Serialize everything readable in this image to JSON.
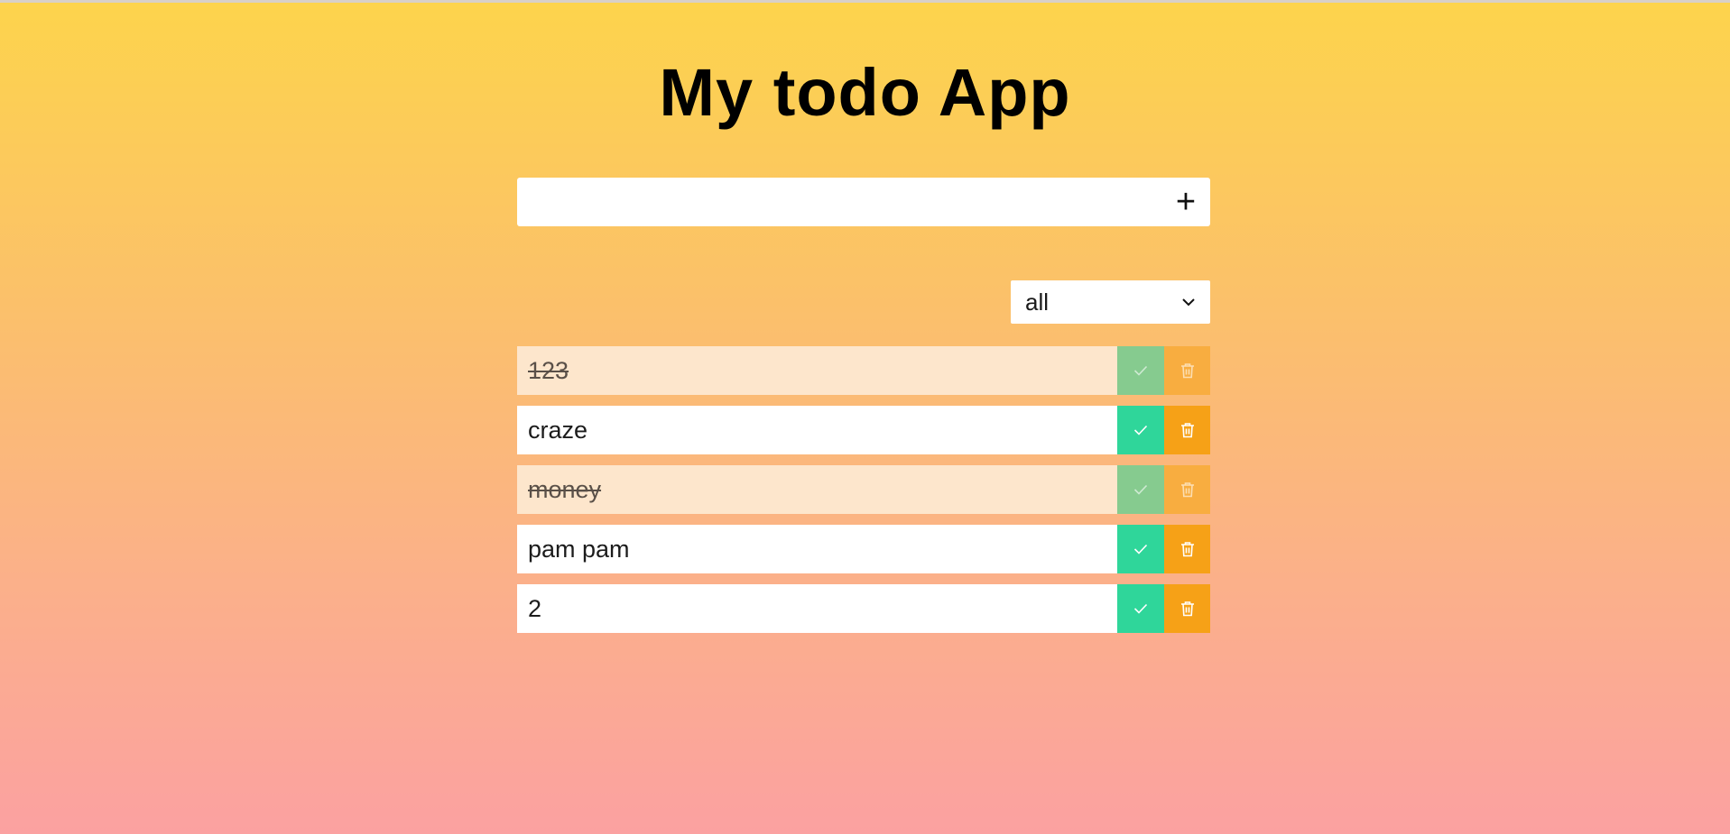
{
  "app": {
    "title": "My todo App"
  },
  "add_form": {
    "input_value": "",
    "button_icon": "plus-icon",
    "button_label": "+"
  },
  "filter": {
    "selected": "all",
    "icon": "chevron-down-icon"
  },
  "todos": [
    {
      "text": "123",
      "completed": true
    },
    {
      "text": "craze",
      "completed": false
    },
    {
      "text": "money",
      "completed": true
    },
    {
      "text": "pam pam",
      "completed": false
    },
    {
      "text": "2",
      "completed": false
    }
  ],
  "icons": {
    "check": "check-icon",
    "trash": "trash-icon"
  },
  "colors": {
    "check_active": "#2fd69a",
    "trash_active": "#f6a117",
    "completed_row": "#fde6cc"
  }
}
